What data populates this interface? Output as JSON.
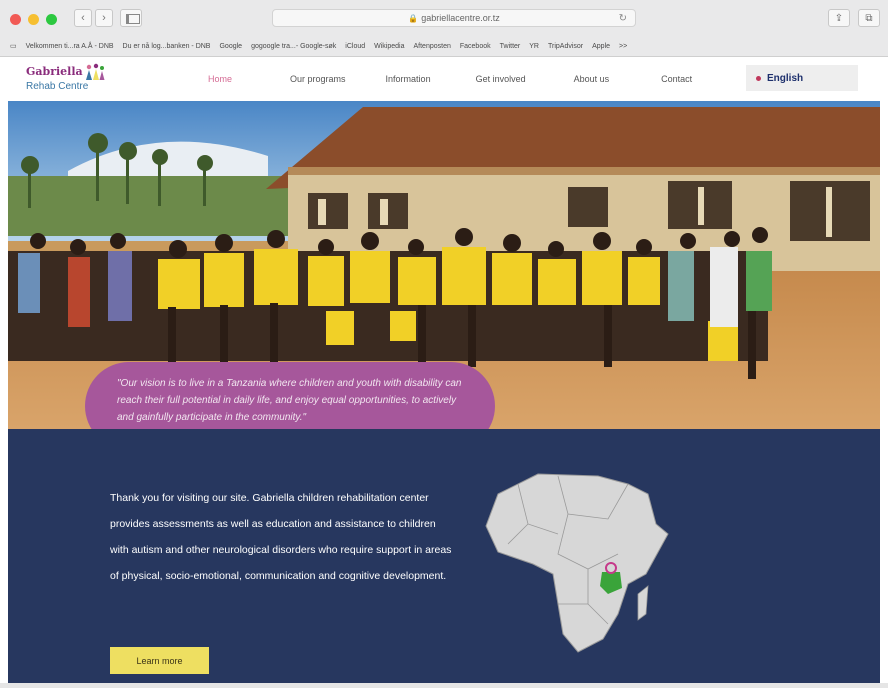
{
  "browser": {
    "url": "gabriellacentre.or.tz",
    "bookmarks": [
      "Velkommen ti...ra A.Å - DNB",
      "Du er nå log...banken - DNB",
      "Google",
      "gogoogle tra...- Google-søk",
      "iCloud",
      "Wikipedia",
      "Aftenposten",
      "Facebook",
      "Twitter",
      "YR",
      "TripAdvisor",
      "Apple",
      ">>"
    ],
    "bookmark_icon": "reading-list-icon"
  },
  "site": {
    "logo_title": "Gabriella",
    "logo_subtitle": "Rehab Centre",
    "nav": [
      "Home",
      "Our programs",
      "Information",
      "Get involved",
      "About us",
      "Contact"
    ],
    "nav_active": "Home",
    "language": "English"
  },
  "hero": {
    "quote": "\"Our vision is to live in a Tanzania where children and youth with disability can reach their full potential in daily life, and enjoy equal opportunities, to actively and gainfully participate in the community.\""
  },
  "info": {
    "text": "Thank you for visiting our site. Gabriella children rehabilitation center provides assessments as well as education and assistance to children with autism and other neurological disorders who require support in areas of physical, socio-emotional, communication and cognitive development.",
    "button": "Learn more"
  },
  "colors": {
    "brand_purple": "#a6579b",
    "navy": "#27375f",
    "button_yellow": "#eedf61",
    "tanzania_green": "#3aa43a"
  }
}
